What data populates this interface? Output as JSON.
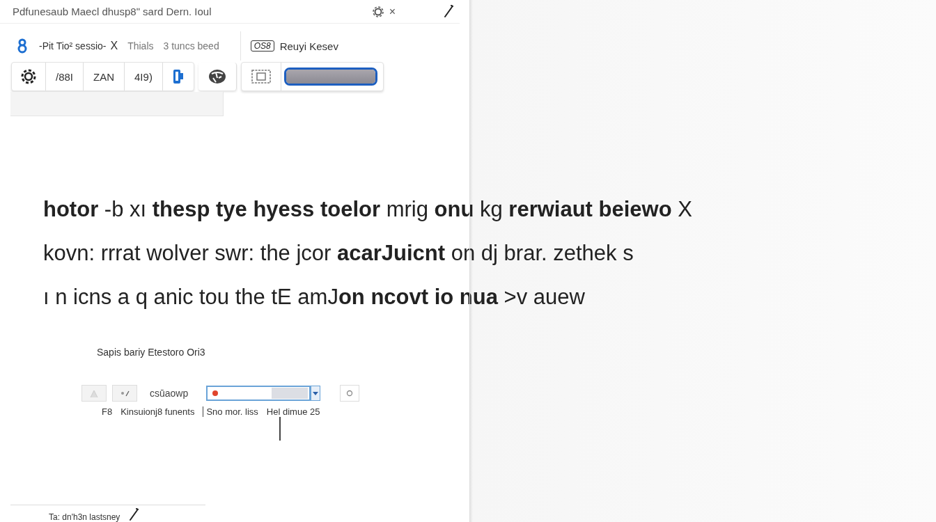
{
  "window": {
    "title": "Pdfunesaub Maecl dhusp8ʺ sard Dern. Ioul",
    "close": "×"
  },
  "tabs": [
    {
      "label": "-Pit Tio² sessio-",
      "close": "X",
      "selected": true
    },
    {
      "label": "Thials",
      "selected": false
    },
    {
      "label": "3 tuncs beed",
      "selected": false
    }
  ],
  "tag": "OS8",
  "user": "Reuyi Kesev",
  "toolbar": [
    {
      "kind": "settings"
    },
    {
      "kind": "text",
      "label": "/88I"
    },
    {
      "kind": "text",
      "label": "ZAN"
    },
    {
      "kind": "text",
      "label": "4I9)"
    },
    {
      "kind": "phone"
    },
    {
      "kind": "globe"
    },
    {
      "kind": "frame"
    },
    {
      "kind": "progress",
      "level": 1
    }
  ],
  "paragraph": [
    "**hotor** -b xı **thesp tye hyess toelor** mrig **onu** kg **rerwiaut beiewo** X",
    "kovn: rrrat wolver swr: the jcor **acarJuicnt** on dj brar. zethek s",
    "ı n icns a q anic tou the tE amJ**on ncovt io nua** >v auew"
  ],
  "caption": "Sapis bariy Etestoro Ori3",
  "controls": {
    "label": "csūaowp"
  },
  "status": [
    "F8",
    "Kinsuionj8 funents",
    "Sno mor. liss",
    "Hel dimue 25"
  ],
  "footer": "Ta: dn'h3n lastsney"
}
